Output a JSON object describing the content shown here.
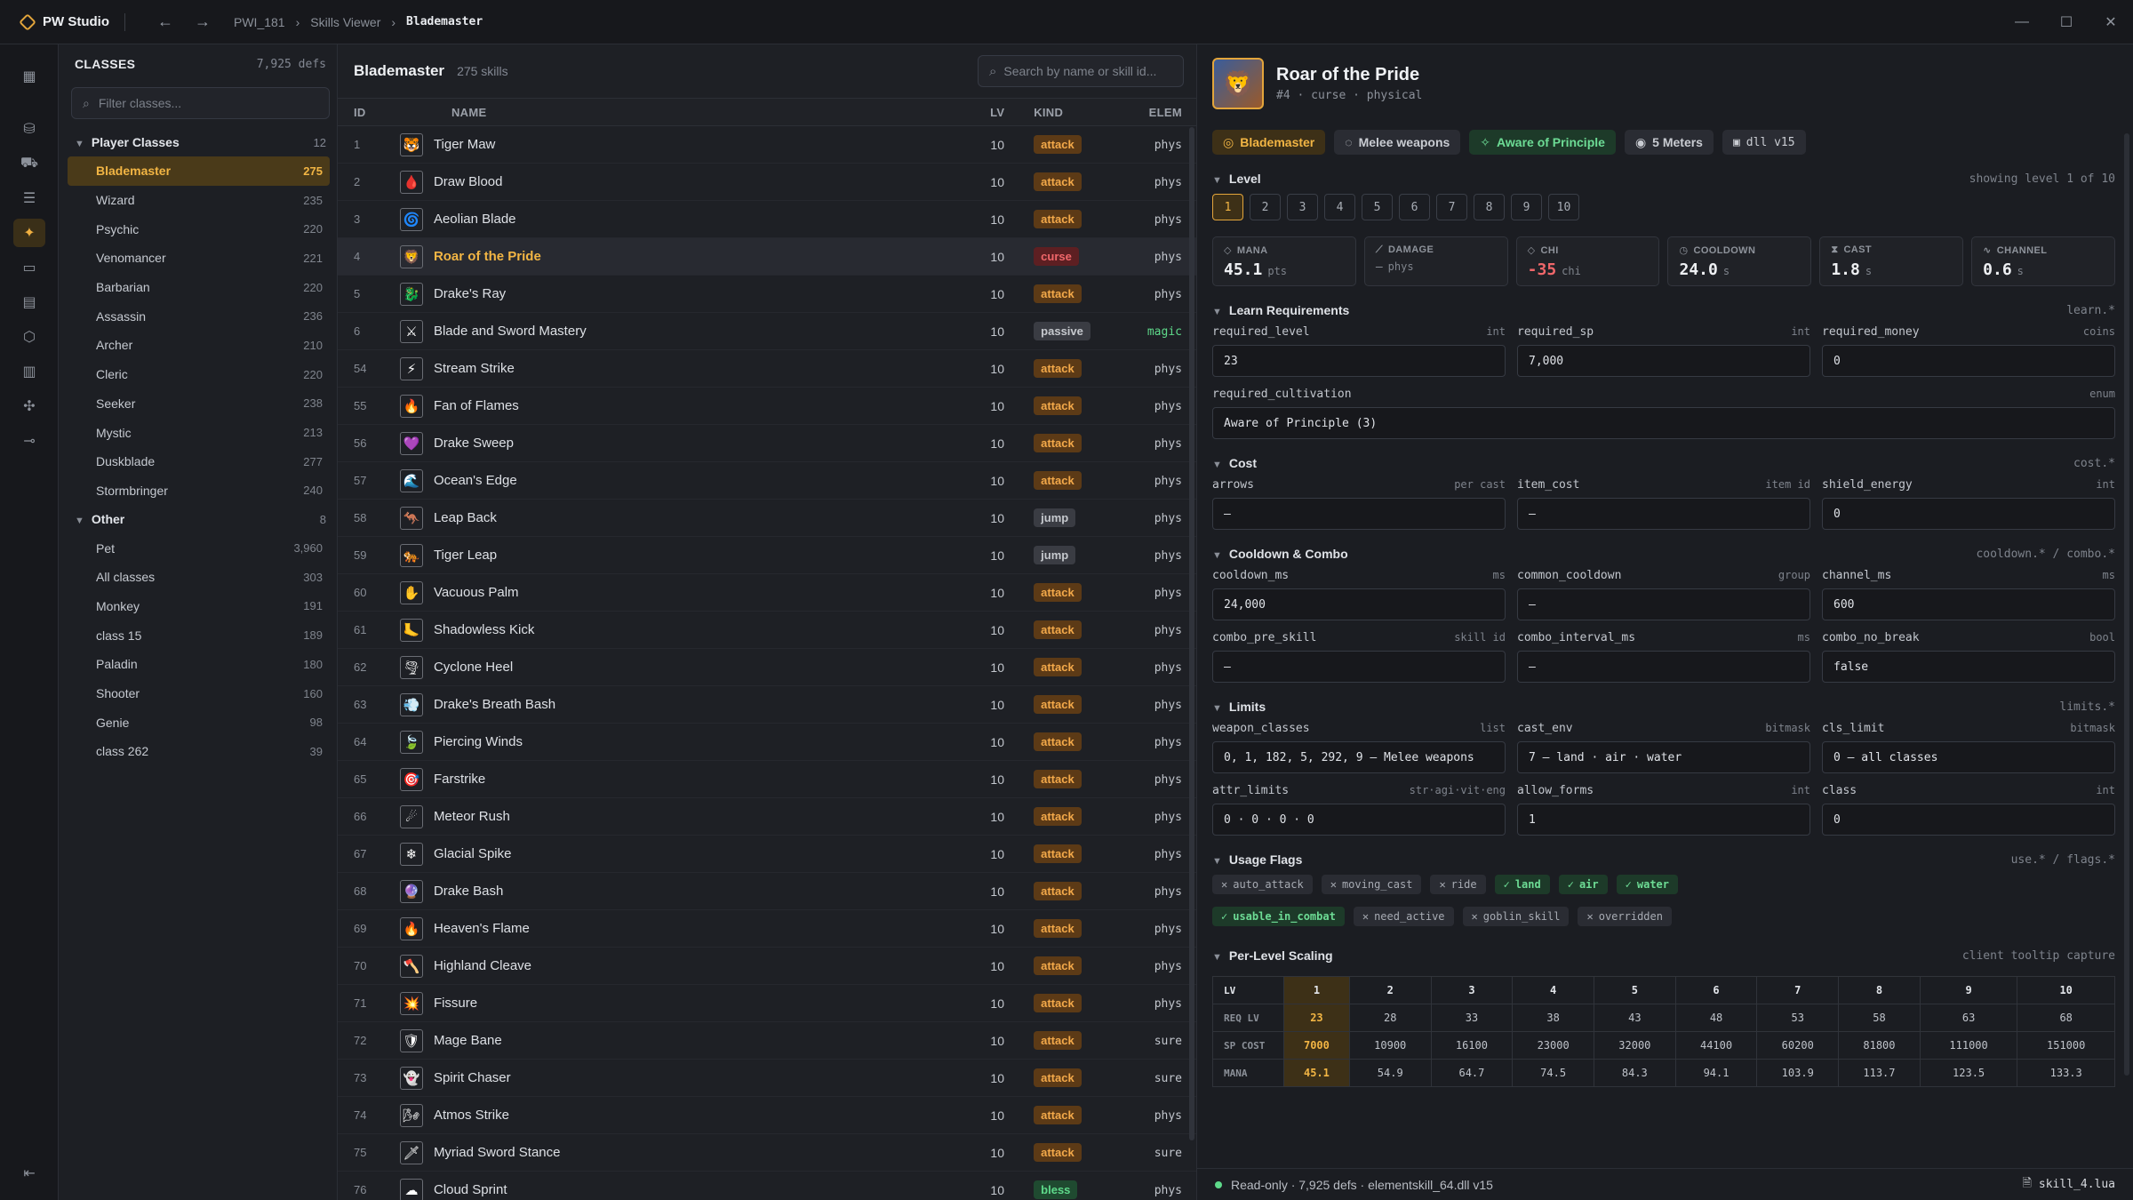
{
  "titlebar": {
    "app_name": "PW Studio",
    "crumbs": [
      "PWI_181",
      "Skills Viewer",
      "Blademaster"
    ]
  },
  "classes": {
    "title": "CLASSES",
    "count": "7,925 defs",
    "filter_placeholder": "Filter classes...",
    "groups": [
      {
        "label": "Player Classes",
        "count": "12",
        "items": [
          {
            "label": "Blademaster",
            "count": "275",
            "active": true
          },
          {
            "label": "Wizard",
            "count": "235"
          },
          {
            "label": "Psychic",
            "count": "220"
          },
          {
            "label": "Venomancer",
            "count": "221"
          },
          {
            "label": "Barbarian",
            "count": "220"
          },
          {
            "label": "Assassin",
            "count": "236"
          },
          {
            "label": "Archer",
            "count": "210"
          },
          {
            "label": "Cleric",
            "count": "220"
          },
          {
            "label": "Seeker",
            "count": "238"
          },
          {
            "label": "Mystic",
            "count": "213"
          },
          {
            "label": "Duskblade",
            "count": "277"
          },
          {
            "label": "Stormbringer",
            "count": "240"
          }
        ]
      },
      {
        "label": "Other",
        "count": "8",
        "items": [
          {
            "label": "Pet",
            "count": "3,960"
          },
          {
            "label": "All classes",
            "count": "303"
          },
          {
            "label": "Monkey",
            "count": "191"
          },
          {
            "label": "class 15",
            "count": "189"
          },
          {
            "label": "Paladin",
            "count": "180"
          },
          {
            "label": "Shooter",
            "count": "160"
          },
          {
            "label": "Genie",
            "count": "98"
          },
          {
            "label": "class 262",
            "count": "39"
          }
        ]
      }
    ]
  },
  "skills": {
    "title": "Blademaster",
    "count": "275 skills",
    "search_placeholder": "Search by name or skill id...",
    "columns": {
      "id": "ID",
      "name": "NAME",
      "lv": "LV",
      "kind": "KIND",
      "elem": "ELEM"
    },
    "rows": [
      {
        "id": "1",
        "name": "Tiger Maw",
        "lv": "10",
        "kind": "attack",
        "elem": "phys",
        "icon": "🐯"
      },
      {
        "id": "2",
        "name": "Draw Blood",
        "lv": "10",
        "kind": "attack",
        "elem": "phys",
        "icon": "🩸"
      },
      {
        "id": "3",
        "name": "Aeolian Blade",
        "lv": "10",
        "kind": "attack",
        "elem": "phys",
        "icon": "🌀"
      },
      {
        "id": "4",
        "name": "Roar of the Pride",
        "lv": "10",
        "kind": "curse",
        "elem": "phys",
        "icon": "🦁",
        "active": true
      },
      {
        "id": "5",
        "name": "Drake's Ray",
        "lv": "10",
        "kind": "attack",
        "elem": "phys",
        "icon": "🐉"
      },
      {
        "id": "6",
        "name": "Blade and Sword Mastery",
        "lv": "10",
        "kind": "passive",
        "elem": "magic",
        "icon": "⚔"
      },
      {
        "id": "54",
        "name": "Stream Strike",
        "lv": "10",
        "kind": "attack",
        "elem": "phys",
        "icon": "⚡"
      },
      {
        "id": "55",
        "name": "Fan of Flames",
        "lv": "10",
        "kind": "attack",
        "elem": "phys",
        "icon": "🔥"
      },
      {
        "id": "56",
        "name": "Drake Sweep",
        "lv": "10",
        "kind": "attack",
        "elem": "phys",
        "icon": "💜"
      },
      {
        "id": "57",
        "name": "Ocean's Edge",
        "lv": "10",
        "kind": "attack",
        "elem": "phys",
        "icon": "🌊"
      },
      {
        "id": "58",
        "name": "Leap Back",
        "lv": "10",
        "kind": "jump",
        "elem": "phys",
        "icon": "🦘"
      },
      {
        "id": "59",
        "name": "Tiger Leap",
        "lv": "10",
        "kind": "jump",
        "elem": "phys",
        "icon": "🐅"
      },
      {
        "id": "60",
        "name": "Vacuous Palm",
        "lv": "10",
        "kind": "attack",
        "elem": "phys",
        "icon": "✋"
      },
      {
        "id": "61",
        "name": "Shadowless Kick",
        "lv": "10",
        "kind": "attack",
        "elem": "phys",
        "icon": "🦶"
      },
      {
        "id": "62",
        "name": "Cyclone Heel",
        "lv": "10",
        "kind": "attack",
        "elem": "phys",
        "icon": "🌪"
      },
      {
        "id": "63",
        "name": "Drake's Breath Bash",
        "lv": "10",
        "kind": "attack",
        "elem": "phys",
        "icon": "💨"
      },
      {
        "id": "64",
        "name": "Piercing Winds",
        "lv": "10",
        "kind": "attack",
        "elem": "phys",
        "icon": "🍃"
      },
      {
        "id": "65",
        "name": "Farstrike",
        "lv": "10",
        "kind": "attack",
        "elem": "phys",
        "icon": "🎯"
      },
      {
        "id": "66",
        "name": "Meteor Rush",
        "lv": "10",
        "kind": "attack",
        "elem": "phys",
        "icon": "☄"
      },
      {
        "id": "67",
        "name": "Glacial Spike",
        "lv": "10",
        "kind": "attack",
        "elem": "phys",
        "icon": "❄"
      },
      {
        "id": "68",
        "name": "Drake Bash",
        "lv": "10",
        "kind": "attack",
        "elem": "phys",
        "icon": "🔮"
      },
      {
        "id": "69",
        "name": "Heaven's Flame",
        "lv": "10",
        "kind": "attack",
        "elem": "phys",
        "icon": "🔥"
      },
      {
        "id": "70",
        "name": "Highland Cleave",
        "lv": "10",
        "kind": "attack",
        "elem": "phys",
        "icon": "🪓"
      },
      {
        "id": "71",
        "name": "Fissure",
        "lv": "10",
        "kind": "attack",
        "elem": "phys",
        "icon": "💥"
      },
      {
        "id": "72",
        "name": "Mage Bane",
        "lv": "10",
        "kind": "attack",
        "elem": "sure",
        "icon": "🛡"
      },
      {
        "id": "73",
        "name": "Spirit Chaser",
        "lv": "10",
        "kind": "attack",
        "elem": "sure",
        "icon": "👻"
      },
      {
        "id": "74",
        "name": "Atmos Strike",
        "lv": "10",
        "kind": "attack",
        "elem": "phys",
        "icon": "🌬"
      },
      {
        "id": "75",
        "name": "Myriad Sword Stance",
        "lv": "10",
        "kind": "attack",
        "elem": "sure",
        "icon": "🗡"
      },
      {
        "id": "76",
        "name": "Cloud Sprint",
        "lv": "10",
        "kind": "bless",
        "elem": "phys",
        "icon": "☁"
      }
    ]
  },
  "detail": {
    "name": "Roar of the Pride",
    "subtitle": "#4 · curse · physical",
    "chips": [
      {
        "label": "Blademaster",
        "style": "gold",
        "icon": "◎"
      },
      {
        "label": "Melee weapons",
        "style": "plain",
        "icon": "◌"
      },
      {
        "label": "Aware of Principle",
        "style": "green",
        "icon": "✧"
      },
      {
        "label": "5 Meters",
        "style": "plain",
        "icon": "◉"
      },
      {
        "label": "dll v15",
        "style": "mono",
        "icon": "▣"
      }
    ],
    "level": {
      "title": "Level",
      "right": "showing level 1 of 10",
      "levels": [
        "1",
        "2",
        "3",
        "4",
        "5",
        "6",
        "7",
        "8",
        "9",
        "10"
      ],
      "active": "1"
    },
    "stats": [
      {
        "label": "MANA",
        "value": "45.1",
        "unit": "pts",
        "icon": "◇"
      },
      {
        "label": "DAMAGE",
        "value": "—",
        "unit": "phys",
        "icon": "⟋",
        "dim": true
      },
      {
        "label": "CHI",
        "value": "-35",
        "unit": "chi",
        "icon": "◇",
        "neg": true
      },
      {
        "label": "COOLDOWN",
        "value": "24.0",
        "unit": "s",
        "icon": "◷"
      },
      {
        "label": "CAST",
        "value": "1.8",
        "unit": "s",
        "icon": "⧗"
      },
      {
        "label": "CHANNEL",
        "value": "0.6",
        "unit": "s",
        "icon": "∿"
      }
    ],
    "sections": [
      {
        "title": "Learn Requirements",
        "right": "learn.*",
        "fields": [
          {
            "name": "required_level",
            "type": "int",
            "value": "23"
          },
          {
            "name": "required_sp",
            "type": "int",
            "value": "7,000"
          },
          {
            "name": "required_money",
            "type": "coins",
            "value": "0"
          },
          {
            "name": "required_cultivation",
            "type": "enum",
            "value": "Aware of Principle (3)",
            "full": true
          }
        ]
      },
      {
        "title": "Cost",
        "right": "cost.*",
        "fields": [
          {
            "name": "arrows",
            "type": "per cast",
            "value": "—"
          },
          {
            "name": "item_cost",
            "type": "item id",
            "value": "—"
          },
          {
            "name": "shield_energy",
            "type": "int",
            "value": "0"
          }
        ]
      },
      {
        "title": "Cooldown & Combo",
        "right": "cooldown.* / combo.*",
        "fields": [
          {
            "name": "cooldown_ms",
            "type": "ms",
            "value": "24,000"
          },
          {
            "name": "common_cooldown",
            "type": "group",
            "value": "—"
          },
          {
            "name": "channel_ms",
            "type": "ms",
            "value": "600"
          },
          {
            "name": "combo_pre_skill",
            "type": "skill id",
            "value": "—"
          },
          {
            "name": "combo_interval_ms",
            "type": "ms",
            "value": "—"
          },
          {
            "name": "combo_no_break",
            "type": "bool",
            "value": "false"
          }
        ]
      },
      {
        "title": "Limits",
        "right": "limits.*",
        "fields": [
          {
            "name": "weapon_classes",
            "type": "list",
            "value": "0, 1, 182, 5, 292, 9 — Melee weapons"
          },
          {
            "name": "cast_env",
            "type": "bitmask",
            "value": "7 — land · air · water"
          },
          {
            "name": "cls_limit",
            "type": "bitmask",
            "value": "0 — all classes"
          },
          {
            "name": "attr_limits",
            "type": "str·agi·vit·eng",
            "value": "0 · 0 · 0 · 0"
          },
          {
            "name": "allow_forms",
            "type": "int",
            "value": "1"
          },
          {
            "name": "class",
            "type": "int",
            "value": "0"
          }
        ]
      }
    ],
    "flags": {
      "title": "Usage Flags",
      "right": "use.* / flags.*",
      "items": [
        {
          "label": "auto_attack",
          "on": false
        },
        {
          "label": "moving_cast",
          "on": false
        },
        {
          "label": "ride",
          "on": false
        },
        {
          "label": "land",
          "on": true
        },
        {
          "label": "air",
          "on": true
        },
        {
          "label": "water",
          "on": true
        },
        {
          "label": "usable_in_combat",
          "on": true
        },
        {
          "label": "need_active",
          "on": false
        },
        {
          "label": "goblin_skill",
          "on": false
        },
        {
          "label": "overridden",
          "on": false
        }
      ]
    },
    "scaling": {
      "title": "Per-Level Scaling",
      "right": "client tooltip capture",
      "rows": [
        {
          "label": "LV",
          "values": [
            "1",
            "2",
            "3",
            "4",
            "5",
            "6",
            "7",
            "8",
            "9",
            "10"
          ]
        },
        {
          "label": "REQ LV",
          "values": [
            "23",
            "28",
            "33",
            "38",
            "43",
            "48",
            "53",
            "58",
            "63",
            "68"
          ]
        },
        {
          "label": "SP COST",
          "values": [
            "7000",
            "10900",
            "16100",
            "23000",
            "32000",
            "44100",
            "60200",
            "81800",
            "111000",
            "151000"
          ]
        },
        {
          "label": "MANA",
          "values": [
            "45.1",
            "54.9",
            "64.7",
            "74.5",
            "84.3",
            "94.1",
            "103.9",
            "113.7",
            "123.5",
            "133.3"
          ]
        }
      ]
    }
  },
  "status": {
    "text": "Read-only · 7,925 defs · elementskill_64.dll v15",
    "file": "skill_4.lua"
  },
  "colors": {
    "accent": "#f2b544",
    "positive": "#5ed98a",
    "negative": "#f0676a"
  }
}
